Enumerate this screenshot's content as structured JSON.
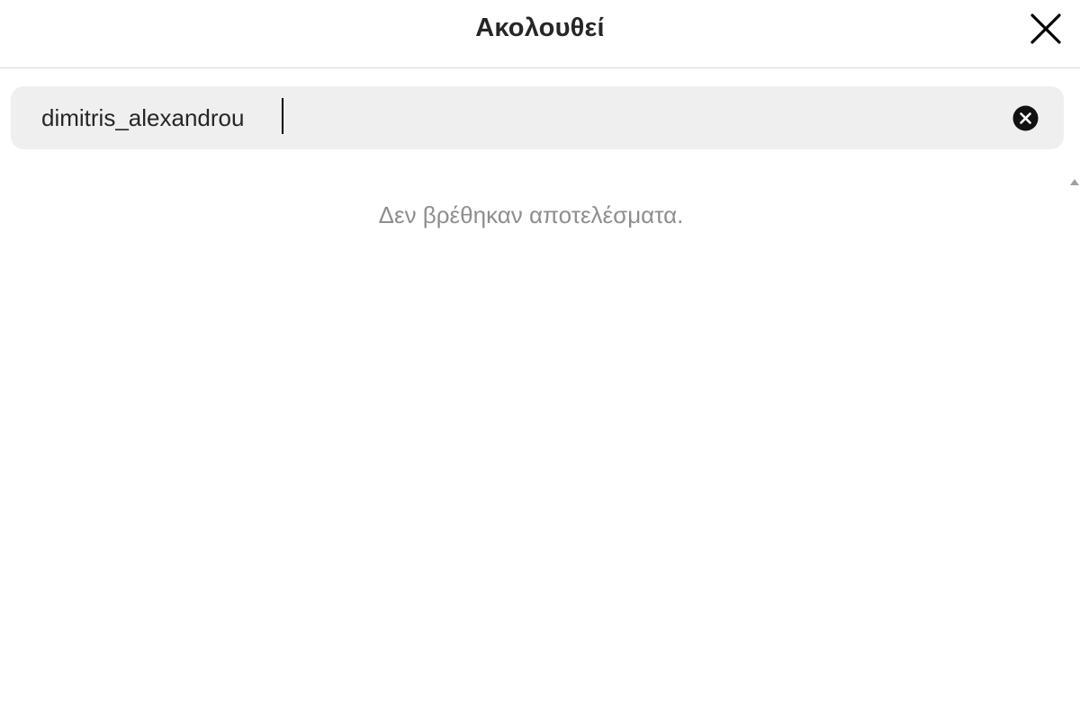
{
  "header": {
    "title": "Ακολουθεί",
    "close_icon": "close-icon"
  },
  "search": {
    "value": "dimitris_alexandrou",
    "clear_icon": "clear-circle-icon"
  },
  "results": {
    "empty_message": "Δεν βρέθηκαν αποτελέσματα."
  },
  "colors": {
    "text": "#262626",
    "muted": "#8e8e8e",
    "search_bg": "#efefef",
    "divider": "#dbdbdb"
  }
}
